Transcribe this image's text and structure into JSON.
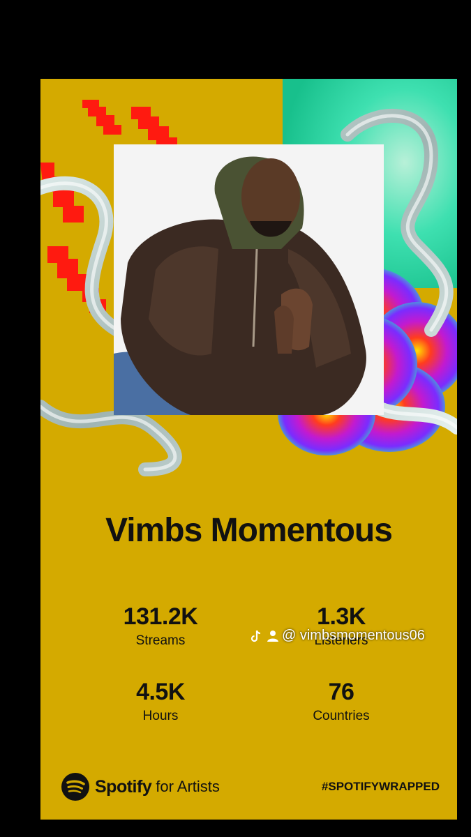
{
  "artist": {
    "name": "Vimbs Momentous"
  },
  "stats": [
    {
      "value": "131.2K",
      "label": "Streams"
    },
    {
      "value": "1.3K",
      "label": "Listeners"
    },
    {
      "value": "4.5K",
      "label": "Hours"
    },
    {
      "value": "76",
      "label": "Countries"
    }
  ],
  "footer": {
    "brand": "Spotify",
    "brand_suffix": "for Artists",
    "hashtag": "#SPOTIFYWRAPPED",
    "logo_icon": "spotify-logo-icon"
  },
  "watermark": {
    "handle": "@ vimbsmomentous06",
    "icons": [
      "tiktok-icon",
      "user-icon"
    ]
  },
  "colors": {
    "card_background": "#d4aa00",
    "page_background": "#000000",
    "text": "#111111"
  }
}
